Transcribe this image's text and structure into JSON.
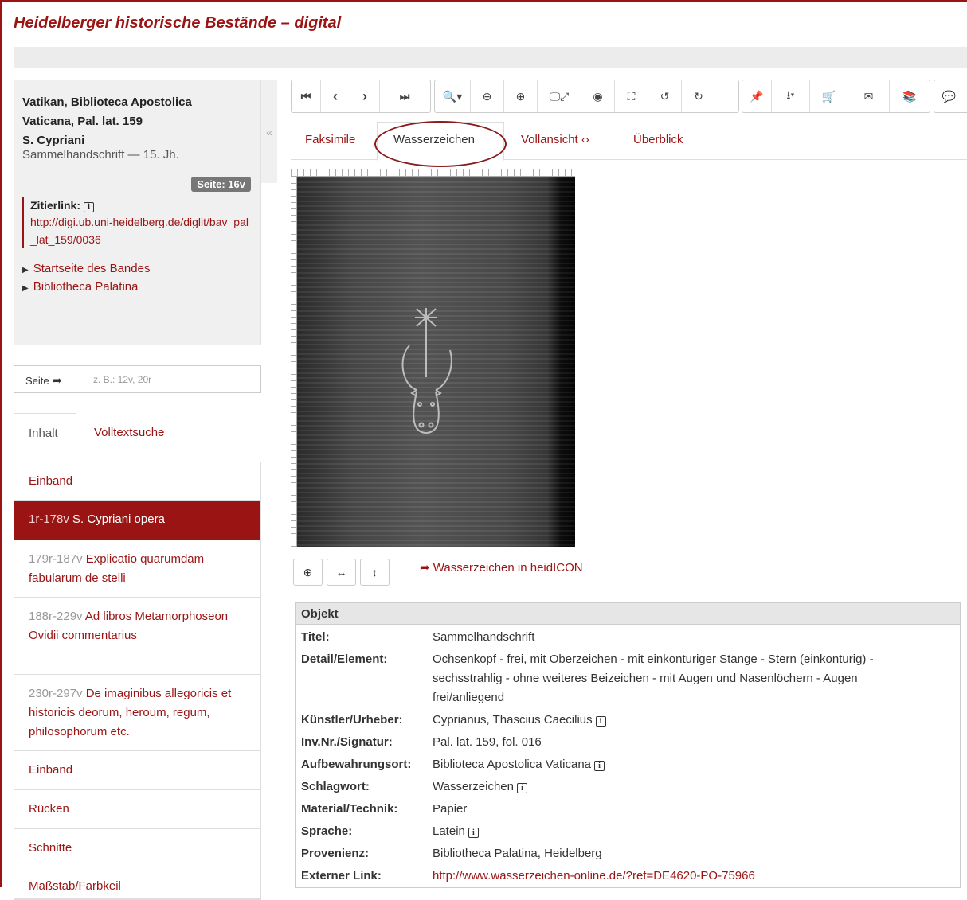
{
  "site": {
    "title": "Heidelberger historische Bestände – digital"
  },
  "info": {
    "line1": "Vatikan, Biblioteca Apostolica",
    "line2": "Vaticana, Pal. lat. 159",
    "line3": "S. Cypriani",
    "line4": "Sammelhandschrift — 15. Jh.",
    "page_badge": "Seite: 16v",
    "cite_label": "Zitierlink:",
    "cite_url": "http://digi.ub.uni-heidelberg.de/diglit/bav_pal_lat_159/0036",
    "link1": "Startseite des Bandes",
    "link2": "Bibliotheca Palatina",
    "collapse": "«"
  },
  "page_jump": {
    "label": "Seite",
    "placeholder": "z. B.: 12v, 20r"
  },
  "left_tabs": {
    "active": "Inhalt",
    "other": "Volltextsuche"
  },
  "toc": [
    {
      "pages": "",
      "title": "Einband"
    },
    {
      "pages": "1r-178v",
      "title": "S. Cypriani opera"
    },
    {
      "pages": "179r-187v",
      "title": "Explicatio quarumdam fabularum de stelli"
    },
    {
      "pages": "188r-229v",
      "title": "Ad libros Metamorphoseon Ovidii commentarius"
    },
    {
      "pages": "230r-297v",
      "title": "De imaginibus allegoricis et historicis deorum, heroum, regum, philosophorum etc."
    },
    {
      "pages": "",
      "title": "Einband"
    },
    {
      "pages": "",
      "title": "Rücken"
    },
    {
      "pages": "",
      "title": "Schnitte"
    },
    {
      "pages": "",
      "title": "Maßstab/Farbkeil"
    }
  ],
  "view_tabs": {
    "t1": "Faksimile",
    "t2": "Wasserzeichen",
    "t3": "Vollansicht ‹›",
    "t4": "Überblick"
  },
  "image_tools": {
    "heidicon_link": "Wasserzeichen in heidICON"
  },
  "meta": {
    "header": "Objekt",
    "rows": [
      {
        "key": "Titel:",
        "value": "Sammelhandschrift"
      },
      {
        "key": "Detail/Element:",
        "value": "Ochsenkopf - frei, mit Oberzeichen - mit einkonturiger Stange - Stern (einkonturig) - sechsstrahlig - ohne weiteres Beizeichen - mit Augen und Nasenlöchern - Augen frei/anliegend"
      },
      {
        "key": "Künstler/Urheber:",
        "value": "Cyprianus, Thascius Caecilius"
      },
      {
        "key": "Inv.Nr./Signatur:",
        "value": "Pal. lat. 159, fol. 016"
      },
      {
        "key": "Aufbewahrungsort:",
        "value": "Biblioteca Apostolica Vaticana"
      },
      {
        "key": "Schlagwort:",
        "value": "Wasserzeichen"
      },
      {
        "key": "Material/Technik:",
        "value": "Papier"
      },
      {
        "key": "Sprache:",
        "value": "Latein"
      },
      {
        "key": "Provenienz:",
        "value": "Bibliotheca Palatina, Heidelberg"
      },
      {
        "key": "Externer Link:",
        "value": "http://www.wasserzeichen-online.de/?ref=DE4620-PO-75966"
      }
    ]
  },
  "colors": {
    "accent": "#9b1414",
    "panel": "#f0f0f0",
    "active_item": "#9b1414"
  }
}
